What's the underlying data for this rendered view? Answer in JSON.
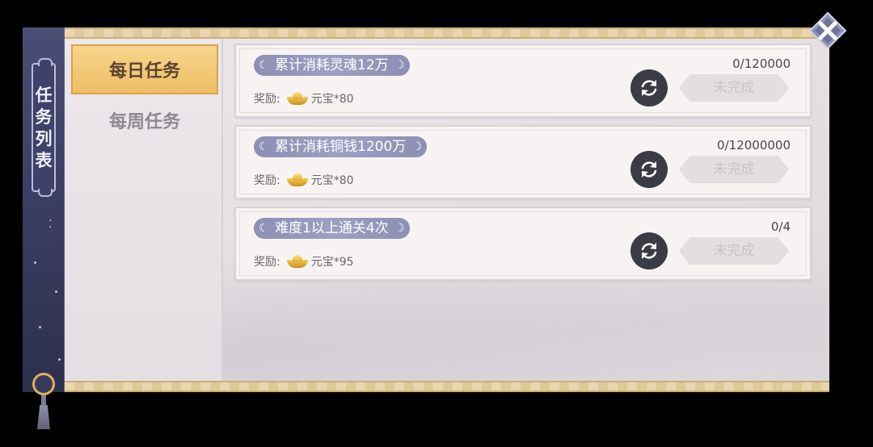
{
  "sidebar": {
    "title_chars": [
      "任",
      "务",
      "列",
      "表"
    ]
  },
  "tabs": [
    {
      "label": "每日任务",
      "active": true
    },
    {
      "label": "每周任务",
      "active": false
    }
  ],
  "tasks": [
    {
      "name": "累计消耗灵魂12万",
      "progress": "0/120000",
      "reward_label": "奖励:",
      "reward_item": "元宝*80",
      "status": "未完成"
    },
    {
      "name": "累计消耗铜钱1200万",
      "progress": "0/12000000",
      "reward_label": "奖励:",
      "reward_item": "元宝*80",
      "status": "未完成"
    },
    {
      "name": "难度1以上通关4次",
      "progress": "0/4",
      "reward_label": "奖励:",
      "reward_item": "元宝*95",
      "status": "未完成"
    }
  ],
  "colors": {
    "active_tab": "#efbe65",
    "task_pill": "#9ea0c2",
    "scroll": "#3b3f63",
    "refresh_button": "#3a3b45"
  },
  "icons": [
    "refresh-icon",
    "close-icon",
    "gold-ingot-icon",
    "crescent-moon-icon"
  ]
}
